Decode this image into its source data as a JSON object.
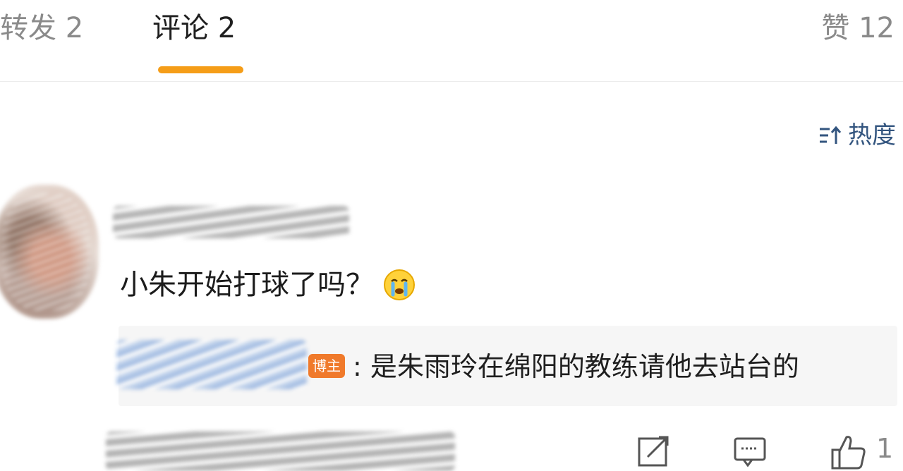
{
  "tabs": {
    "repost": "转发 2",
    "comment": "评论 2",
    "like": "赞 12"
  },
  "sort": {
    "label": "热度",
    "icon": "sort-icon"
  },
  "comment": {
    "text": "小朱开始打球了吗？",
    "emoji": "crying-face-icon"
  },
  "reply": {
    "badge": "博主",
    "text": ": 是朱雨玲在绵阳的教练请他去站台的"
  },
  "next_comment": {
    "like_count": "1"
  },
  "colors": {
    "accent": "#f59d18",
    "link": "#33557f",
    "badge": "#f07a2b"
  }
}
